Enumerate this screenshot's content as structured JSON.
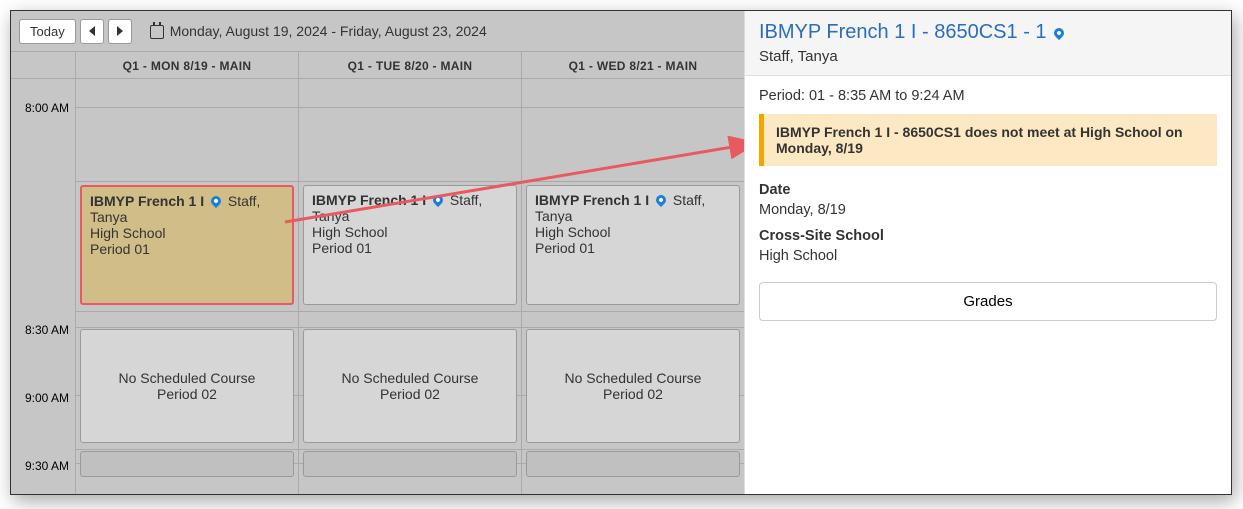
{
  "toolbar": {
    "today": "Today",
    "range": "Monday, August 19, 2024 - Friday, August 23, 2024"
  },
  "headers": [
    "Q1 - MON 8/19 - MAIN",
    "Q1 - TUE 8/20 - MAIN",
    "Q1 - WED 8/21 - MAIN"
  ],
  "times": {
    "t1": "8:00 AM",
    "t2": "8:30 AM",
    "t3": "9:00 AM",
    "t4": "9:30 AM"
  },
  "event": {
    "title": "IBMYP French 1 I",
    "staff": "Staff, Tanya",
    "school": "High School",
    "period": "Period 01"
  },
  "nosched": {
    "line1": "No Scheduled Course",
    "line2": "Period 02"
  },
  "panel": {
    "title": "IBMYP French 1 I - 8650CS1 - 1",
    "staff": "Staff, Tanya",
    "period": "Period: 01 - 8:35 AM to 9:24 AM",
    "alert": "IBMYP French 1 I - 8650CS1 does not meet at High School on Monday, 8/19",
    "date_label": "Date",
    "date_value": "Monday, 8/19",
    "school_label": "Cross-Site School",
    "school_value": "High School",
    "grades": "Grades"
  }
}
